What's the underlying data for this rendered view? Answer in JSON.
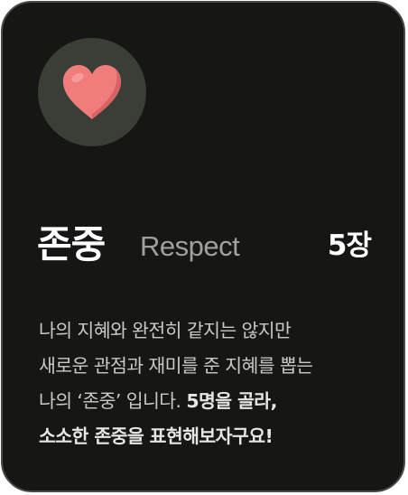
{
  "card": {
    "icon": "heart-icon",
    "icon_color": "#f07c7c",
    "title_ko": "존중",
    "title_en": "Respect",
    "count": "5장",
    "description": {
      "line1": "나의 지혜와 완전히 같지는 않지만",
      "line2": "새로운 관점과 재미를 준 지혜를 뽑는",
      "line3_plain": "나의 ‘존중’ 입니다. ",
      "line3_bold": "5명을 골라,",
      "line4_bold": "소소한 존중을 표현해보자구요!"
    }
  }
}
